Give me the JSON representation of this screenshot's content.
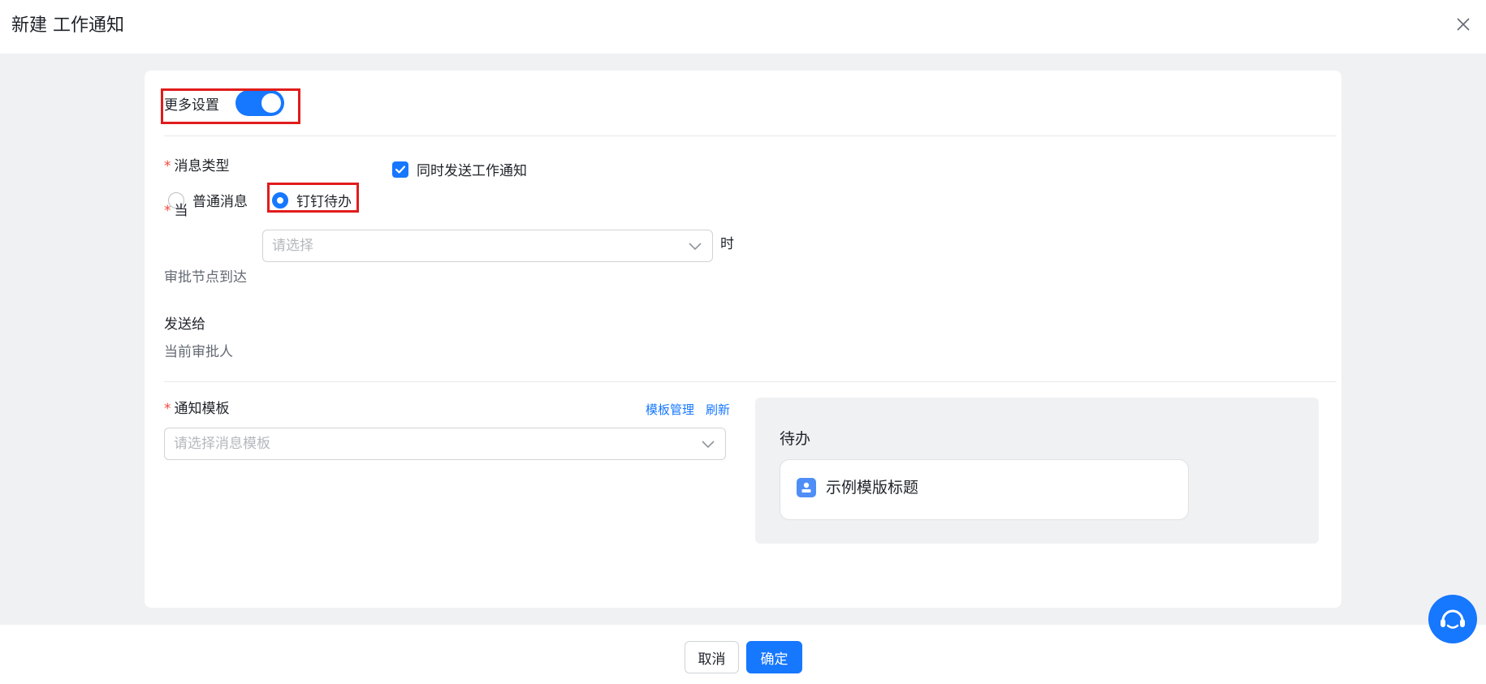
{
  "header": {
    "title": "新建 工作通知",
    "close_icon": "close-icon"
  },
  "more_settings": {
    "label": "更多设置",
    "enabled": true
  },
  "message_type": {
    "label": "消息类型",
    "required_mark": "*",
    "also_send": {
      "label": "同时发送工作通知",
      "checked": true
    },
    "options": [
      {
        "label": "普通消息",
        "selected": false
      },
      {
        "label": "钉钉待办",
        "selected": true
      }
    ]
  },
  "when": {
    "label": "当",
    "required_mark": "*",
    "select_placeholder": "请选择",
    "suffix": "时",
    "value_text": "审批节点到达"
  },
  "send_to": {
    "label": "发送给",
    "value": "当前审批人"
  },
  "template": {
    "label": "通知模板",
    "required_mark": "*",
    "manage_link": "模板管理",
    "refresh_link": "刷新",
    "select_placeholder": "请选择消息模板"
  },
  "preview": {
    "title": "待办",
    "item_text": "示例模版标题"
  },
  "footer": {
    "cancel_label": "取消",
    "ok_label": "确定"
  },
  "colors": {
    "primary": "#1677ff",
    "highlight": "#e11c1c",
    "required": "#f5483b"
  }
}
